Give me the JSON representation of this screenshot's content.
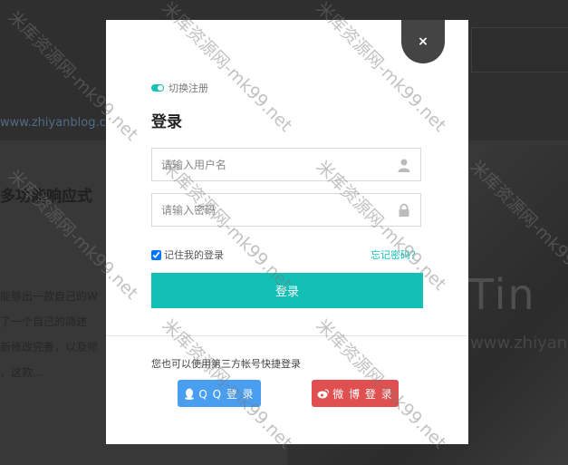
{
  "background": {
    "site_url": "www.zhiyanblog.com",
    "article_heading": "多功能响应式",
    "article_lines": [
      "能够出一款自己的W",
      "了一个自己的简述",
      "新修改完善，以及师",
      "，这款..."
    ],
    "photo_text": "Tin",
    "photo_url": "www.zhiyan"
  },
  "modal": {
    "close_symbol": "×",
    "switch_label": "切换注册",
    "title": "登录",
    "username_placeholder": "请输入用户名",
    "password_placeholder": "请输入密码",
    "remember_label": "记住我的登录",
    "remember_checked": true,
    "forgot_label": "忘记密码？",
    "login_button": "登录",
    "quick_login_text": "您也可以使用第三方帐号快捷登录",
    "qq_button": "Q Q 登 录",
    "weibo_button": "微 博 登 录",
    "colors": {
      "accent": "#12c0b5",
      "qq": "#4a9ef0",
      "weibo": "#e05050"
    }
  },
  "watermark": "米库资源网-mk99.net",
  "icons": {
    "close": "close-icon",
    "switch": "toggle-icon",
    "user": "user-icon",
    "lock": "lock-icon",
    "qq": "qq-icon",
    "weibo": "weibo-icon"
  }
}
